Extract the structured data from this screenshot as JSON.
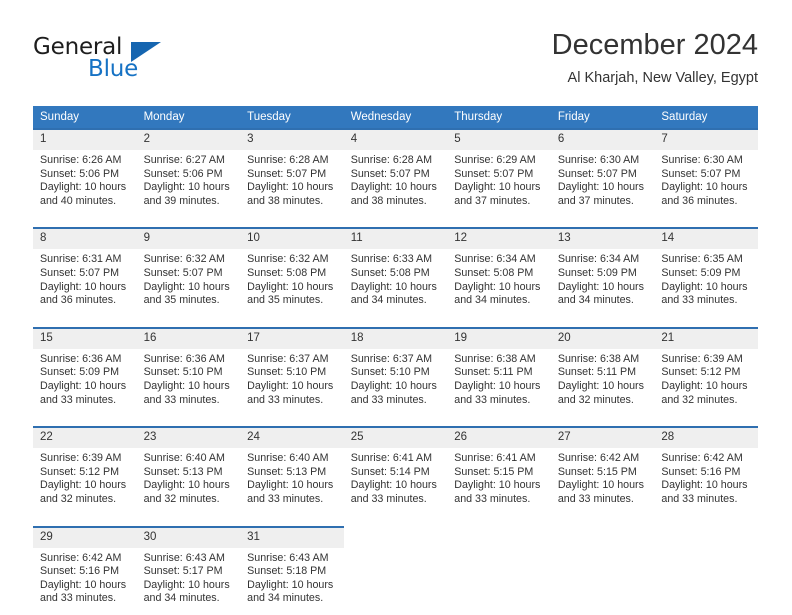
{
  "logo": {
    "general_text": "General",
    "blue_text": "Blue",
    "triangle_color": "#1565b0",
    "blue_color": "#1672c4"
  },
  "header": {
    "title": "December 2024",
    "subtitle": "Al Kharjah, New Valley, Egypt"
  },
  "theme": {
    "header_bg": "#3278be",
    "row_border": "#2f6fb0",
    "daynum_bg": "#efefef",
    "text": "#333333"
  },
  "weekday_headers": [
    "Sunday",
    "Monday",
    "Tuesday",
    "Wednesday",
    "Thursday",
    "Friday",
    "Saturday"
  ],
  "weeks": [
    [
      {
        "day": "1",
        "sunrise": "Sunrise: 6:26 AM",
        "sunset": "Sunset: 5:06 PM",
        "daylight1": "Daylight: 10 hours",
        "daylight2": "and 40 minutes."
      },
      {
        "day": "2",
        "sunrise": "Sunrise: 6:27 AM",
        "sunset": "Sunset: 5:06 PM",
        "daylight1": "Daylight: 10 hours",
        "daylight2": "and 39 minutes."
      },
      {
        "day": "3",
        "sunrise": "Sunrise: 6:28 AM",
        "sunset": "Sunset: 5:07 PM",
        "daylight1": "Daylight: 10 hours",
        "daylight2": "and 38 minutes."
      },
      {
        "day": "4",
        "sunrise": "Sunrise: 6:28 AM",
        "sunset": "Sunset: 5:07 PM",
        "daylight1": "Daylight: 10 hours",
        "daylight2": "and 38 minutes."
      },
      {
        "day": "5",
        "sunrise": "Sunrise: 6:29 AM",
        "sunset": "Sunset: 5:07 PM",
        "daylight1": "Daylight: 10 hours",
        "daylight2": "and 37 minutes."
      },
      {
        "day": "6",
        "sunrise": "Sunrise: 6:30 AM",
        "sunset": "Sunset: 5:07 PM",
        "daylight1": "Daylight: 10 hours",
        "daylight2": "and 37 minutes."
      },
      {
        "day": "7",
        "sunrise": "Sunrise: 6:30 AM",
        "sunset": "Sunset: 5:07 PM",
        "daylight1": "Daylight: 10 hours",
        "daylight2": "and 36 minutes."
      }
    ],
    [
      {
        "day": "8",
        "sunrise": "Sunrise: 6:31 AM",
        "sunset": "Sunset: 5:07 PM",
        "daylight1": "Daylight: 10 hours",
        "daylight2": "and 36 minutes."
      },
      {
        "day": "9",
        "sunrise": "Sunrise: 6:32 AM",
        "sunset": "Sunset: 5:07 PM",
        "daylight1": "Daylight: 10 hours",
        "daylight2": "and 35 minutes."
      },
      {
        "day": "10",
        "sunrise": "Sunrise: 6:32 AM",
        "sunset": "Sunset: 5:08 PM",
        "daylight1": "Daylight: 10 hours",
        "daylight2": "and 35 minutes."
      },
      {
        "day": "11",
        "sunrise": "Sunrise: 6:33 AM",
        "sunset": "Sunset: 5:08 PM",
        "daylight1": "Daylight: 10 hours",
        "daylight2": "and 34 minutes."
      },
      {
        "day": "12",
        "sunrise": "Sunrise: 6:34 AM",
        "sunset": "Sunset: 5:08 PM",
        "daylight1": "Daylight: 10 hours",
        "daylight2": "and 34 minutes."
      },
      {
        "day": "13",
        "sunrise": "Sunrise: 6:34 AM",
        "sunset": "Sunset: 5:09 PM",
        "daylight1": "Daylight: 10 hours",
        "daylight2": "and 34 minutes."
      },
      {
        "day": "14",
        "sunrise": "Sunrise: 6:35 AM",
        "sunset": "Sunset: 5:09 PM",
        "daylight1": "Daylight: 10 hours",
        "daylight2": "and 33 minutes."
      }
    ],
    [
      {
        "day": "15",
        "sunrise": "Sunrise: 6:36 AM",
        "sunset": "Sunset: 5:09 PM",
        "daylight1": "Daylight: 10 hours",
        "daylight2": "and 33 minutes."
      },
      {
        "day": "16",
        "sunrise": "Sunrise: 6:36 AM",
        "sunset": "Sunset: 5:10 PM",
        "daylight1": "Daylight: 10 hours",
        "daylight2": "and 33 minutes."
      },
      {
        "day": "17",
        "sunrise": "Sunrise: 6:37 AM",
        "sunset": "Sunset: 5:10 PM",
        "daylight1": "Daylight: 10 hours",
        "daylight2": "and 33 minutes."
      },
      {
        "day": "18",
        "sunrise": "Sunrise: 6:37 AM",
        "sunset": "Sunset: 5:10 PM",
        "daylight1": "Daylight: 10 hours",
        "daylight2": "and 33 minutes."
      },
      {
        "day": "19",
        "sunrise": "Sunrise: 6:38 AM",
        "sunset": "Sunset: 5:11 PM",
        "daylight1": "Daylight: 10 hours",
        "daylight2": "and 33 minutes."
      },
      {
        "day": "20",
        "sunrise": "Sunrise: 6:38 AM",
        "sunset": "Sunset: 5:11 PM",
        "daylight1": "Daylight: 10 hours",
        "daylight2": "and 32 minutes."
      },
      {
        "day": "21",
        "sunrise": "Sunrise: 6:39 AM",
        "sunset": "Sunset: 5:12 PM",
        "daylight1": "Daylight: 10 hours",
        "daylight2": "and 32 minutes."
      }
    ],
    [
      {
        "day": "22",
        "sunrise": "Sunrise: 6:39 AM",
        "sunset": "Sunset: 5:12 PM",
        "daylight1": "Daylight: 10 hours",
        "daylight2": "and 32 minutes."
      },
      {
        "day": "23",
        "sunrise": "Sunrise: 6:40 AM",
        "sunset": "Sunset: 5:13 PM",
        "daylight1": "Daylight: 10 hours",
        "daylight2": "and 32 minutes."
      },
      {
        "day": "24",
        "sunrise": "Sunrise: 6:40 AM",
        "sunset": "Sunset: 5:13 PM",
        "daylight1": "Daylight: 10 hours",
        "daylight2": "and 33 minutes."
      },
      {
        "day": "25",
        "sunrise": "Sunrise: 6:41 AM",
        "sunset": "Sunset: 5:14 PM",
        "daylight1": "Daylight: 10 hours",
        "daylight2": "and 33 minutes."
      },
      {
        "day": "26",
        "sunrise": "Sunrise: 6:41 AM",
        "sunset": "Sunset: 5:15 PM",
        "daylight1": "Daylight: 10 hours",
        "daylight2": "and 33 minutes."
      },
      {
        "day": "27",
        "sunrise": "Sunrise: 6:42 AM",
        "sunset": "Sunset: 5:15 PM",
        "daylight1": "Daylight: 10 hours",
        "daylight2": "and 33 minutes."
      },
      {
        "day": "28",
        "sunrise": "Sunrise: 6:42 AM",
        "sunset": "Sunset: 5:16 PM",
        "daylight1": "Daylight: 10 hours",
        "daylight2": "and 33 minutes."
      }
    ],
    [
      {
        "day": "29",
        "sunrise": "Sunrise: 6:42 AM",
        "sunset": "Sunset: 5:16 PM",
        "daylight1": "Daylight: 10 hours",
        "daylight2": "and 33 minutes."
      },
      {
        "day": "30",
        "sunrise": "Sunrise: 6:43 AM",
        "sunset": "Sunset: 5:17 PM",
        "daylight1": "Daylight: 10 hours",
        "daylight2": "and 34 minutes."
      },
      {
        "day": "31",
        "sunrise": "Sunrise: 6:43 AM",
        "sunset": "Sunset: 5:18 PM",
        "daylight1": "Daylight: 10 hours",
        "daylight2": "and 34 minutes."
      },
      null,
      null,
      null,
      null
    ]
  ]
}
